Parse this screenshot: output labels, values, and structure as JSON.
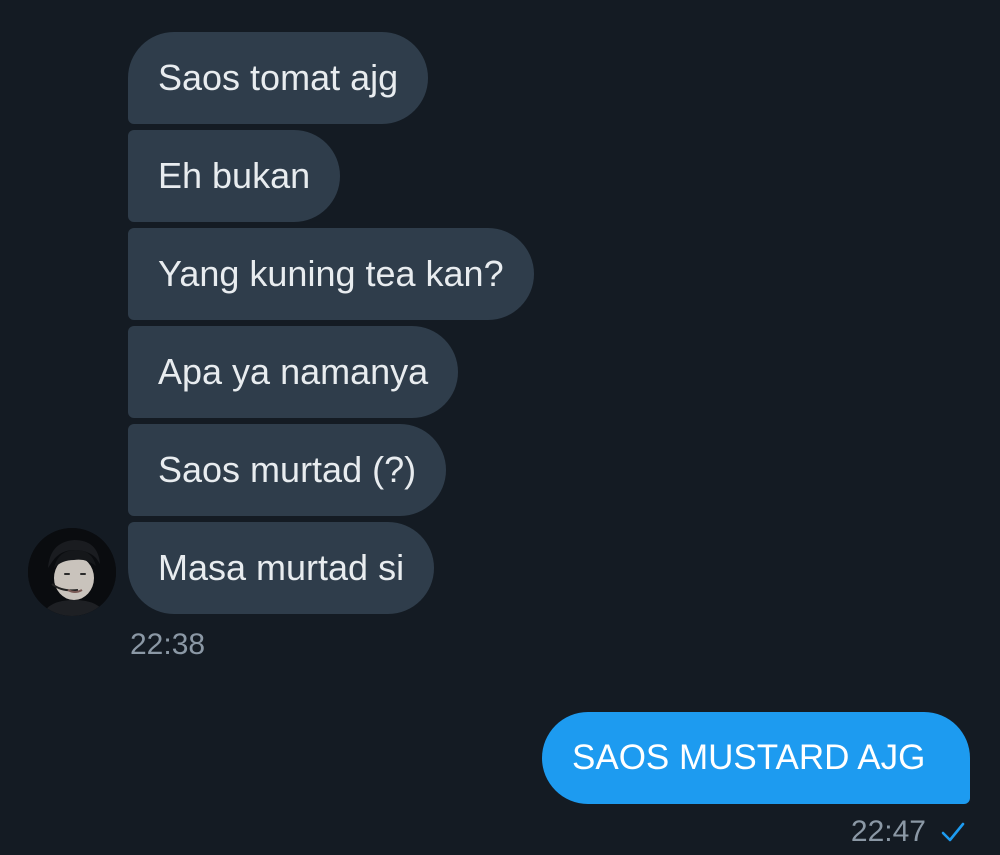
{
  "incoming": {
    "messages": [
      "Saos tomat ajg",
      "Eh bukan",
      "Yang kuning tea kan?",
      "Apa ya namanya",
      "Saos murtad (?)",
      "Masa murtad si"
    ],
    "time": "22:38"
  },
  "outgoing": {
    "message": "SAOS MUSTARD AJG",
    "time": "22:47",
    "status_icon": "check-icon"
  },
  "colors": {
    "background": "#141b23",
    "incoming_bubble": "#2f3d4b",
    "outgoing_bubble": "#1d9bf0",
    "timestamp": "#8b98a5"
  }
}
